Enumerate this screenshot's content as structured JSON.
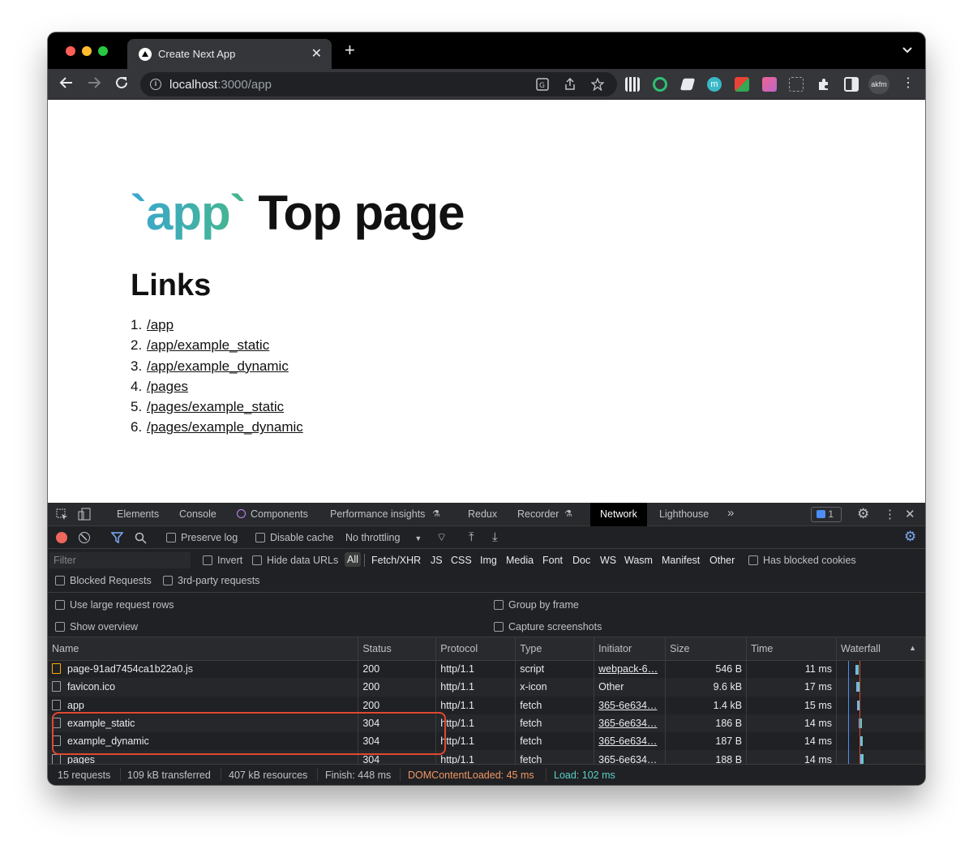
{
  "browser": {
    "tab_title": "Create Next App",
    "tab_close": "✕",
    "new_tab": "+",
    "url_host": "localhost",
    "url_path": ":3000/app",
    "profile": "akfm"
  },
  "page": {
    "heading_code": "`app`",
    "heading_text": "Top page",
    "links_title": "Links",
    "links": [
      {
        "num": "1.",
        "text": "/app"
      },
      {
        "num": "2.",
        "text": "/app/example_static"
      },
      {
        "num": "3.",
        "text": "/app/example_dynamic"
      },
      {
        "num": "4.",
        "text": "/pages"
      },
      {
        "num": "5.",
        "text": "/pages/example_static"
      },
      {
        "num": "6.",
        "text": "/pages/example_dynamic"
      }
    ]
  },
  "devtools": {
    "tabs": [
      "Elements",
      "Console",
      "Components",
      "Performance insights",
      "Redux",
      "Recorder",
      "Network",
      "Lighthouse"
    ],
    "active_tab": "Network",
    "more": "»",
    "issues_count": "1",
    "toolbar": {
      "preserve_log": "Preserve log",
      "disable_cache": "Disable cache",
      "throttling": "No throttling"
    },
    "filter": {
      "placeholder": "Filter",
      "invert": "Invert",
      "hide_data_urls": "Hide data URLs",
      "types": [
        "All",
        "Fetch/XHR",
        "JS",
        "CSS",
        "Img",
        "Media",
        "Font",
        "Doc",
        "WS",
        "Wasm",
        "Manifest",
        "Other"
      ],
      "has_blocked_cookies": "Has blocked cookies",
      "blocked_requests": "Blocked Requests",
      "third_party": "3rd-party requests"
    },
    "settings": {
      "large_rows": "Use large request rows",
      "group_by_frame": "Group by frame",
      "show_overview": "Show overview",
      "capture_screenshots": "Capture screenshots"
    },
    "columns": [
      "Name",
      "Status",
      "Protocol",
      "Type",
      "Initiator",
      "Size",
      "Time",
      "Waterfall"
    ],
    "rows": [
      {
        "name": "page-91ad7454ca1b22a0.js",
        "status": "200",
        "protocol": "http/1.1",
        "type": "script",
        "initiator": "webpack-6…",
        "size": "546 B",
        "time": "11 ms"
      },
      {
        "name": "favicon.ico",
        "status": "200",
        "protocol": "http/1.1",
        "type": "x-icon",
        "initiator": "Other",
        "size": "9.6 kB",
        "time": "17 ms"
      },
      {
        "name": "app",
        "status": "200",
        "protocol": "http/1.1",
        "type": "fetch",
        "initiator": "365-6e634…",
        "size": "1.4 kB",
        "time": "15 ms"
      },
      {
        "name": "example_static",
        "status": "304",
        "protocol": "http/1.1",
        "type": "fetch",
        "initiator": "365-6e634…",
        "size": "186 B",
        "time": "14 ms"
      },
      {
        "name": "example_dynamic",
        "status": "304",
        "protocol": "http/1.1",
        "type": "fetch",
        "initiator": "365-6e634…",
        "size": "187 B",
        "time": "14 ms"
      },
      {
        "name": "pages",
        "status": "304",
        "protocol": "http/1.1",
        "type": "fetch",
        "initiator": "365-6e634…",
        "size": "188 B",
        "time": "14 ms"
      }
    ],
    "summary": {
      "requests": "15 requests",
      "transferred": "109 kB transferred",
      "resources": "407 kB resources",
      "finish": "Finish: 448 ms",
      "dom_loaded": "DOMContentLoaded: 45 ms",
      "load": "Load: 102 ms"
    }
  },
  "colors": {
    "dom_loaded": "#f29766",
    "load": "#5ad1c6",
    "highlight": "#e0492f"
  }
}
